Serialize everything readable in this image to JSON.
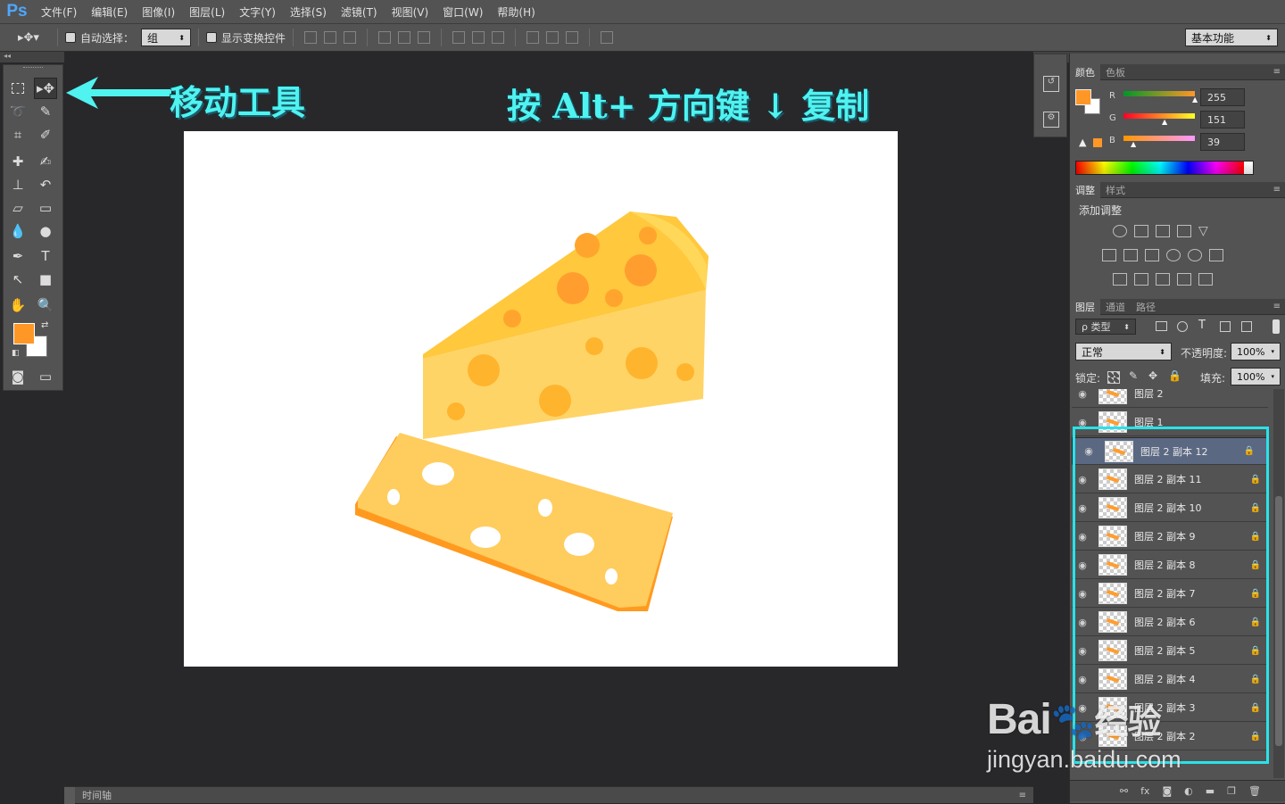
{
  "app": {
    "logo": "Ps"
  },
  "menu": [
    {
      "label": "文件(F)"
    },
    {
      "label": "编辑(E)"
    },
    {
      "label": "图像(I)"
    },
    {
      "label": "图层(L)"
    },
    {
      "label": "文字(Y)"
    },
    {
      "label": "选择(S)"
    },
    {
      "label": "滤镜(T)"
    },
    {
      "label": "视图(V)"
    },
    {
      "label": "窗口(W)"
    },
    {
      "label": "帮助(H)"
    }
  ],
  "options": {
    "auto_select_label": "自动选择：",
    "auto_select_value": "组",
    "show_transform_label": "显示变换控件",
    "workspace": "基本功能"
  },
  "annotations": {
    "move_tool": "移动工具",
    "instruction": "按 Alt+ 方向键 ↓ 复制"
  },
  "color_panel": {
    "tabs": [
      "颜色",
      "色板"
    ],
    "r_label": "R",
    "g_label": "G",
    "b_label": "B",
    "r": "255",
    "g": "151",
    "b": "39",
    "foreground": "#ff9727"
  },
  "adjust_panel": {
    "tabs": [
      "调整",
      "样式"
    ],
    "title": "添加调整"
  },
  "layers_panel": {
    "tabs": [
      "图层",
      "通道",
      "路径"
    ],
    "filter": "ρ 类型",
    "blend_mode": "正常",
    "opacity_label": "不透明度:",
    "opacity": "100%",
    "lock_label": "锁定:",
    "fill_label": "填充:",
    "fill": "100%",
    "layers": [
      {
        "name": "图层 2"
      },
      {
        "name": "图层 1"
      },
      {
        "name": "图层 2 副本 12"
      },
      {
        "name": "图层 2 副本 11"
      },
      {
        "name": "图层 2 副本 10"
      },
      {
        "name": "图层 2 副本 9"
      },
      {
        "name": "图层 2 副本 8"
      },
      {
        "name": "图层 2 副本 7"
      },
      {
        "name": "图层 2 副本 6"
      },
      {
        "name": "图层 2 副本 5"
      },
      {
        "name": "图层 2 副本 4"
      },
      {
        "name": "图层 2 副本 3"
      },
      {
        "name": "图层 2 副本 2"
      }
    ]
  },
  "timeline": {
    "label": "时间轴"
  },
  "watermark": {
    "brand": "Bai",
    "brand2": "经验",
    "url": "jingyan.baidu.com"
  }
}
